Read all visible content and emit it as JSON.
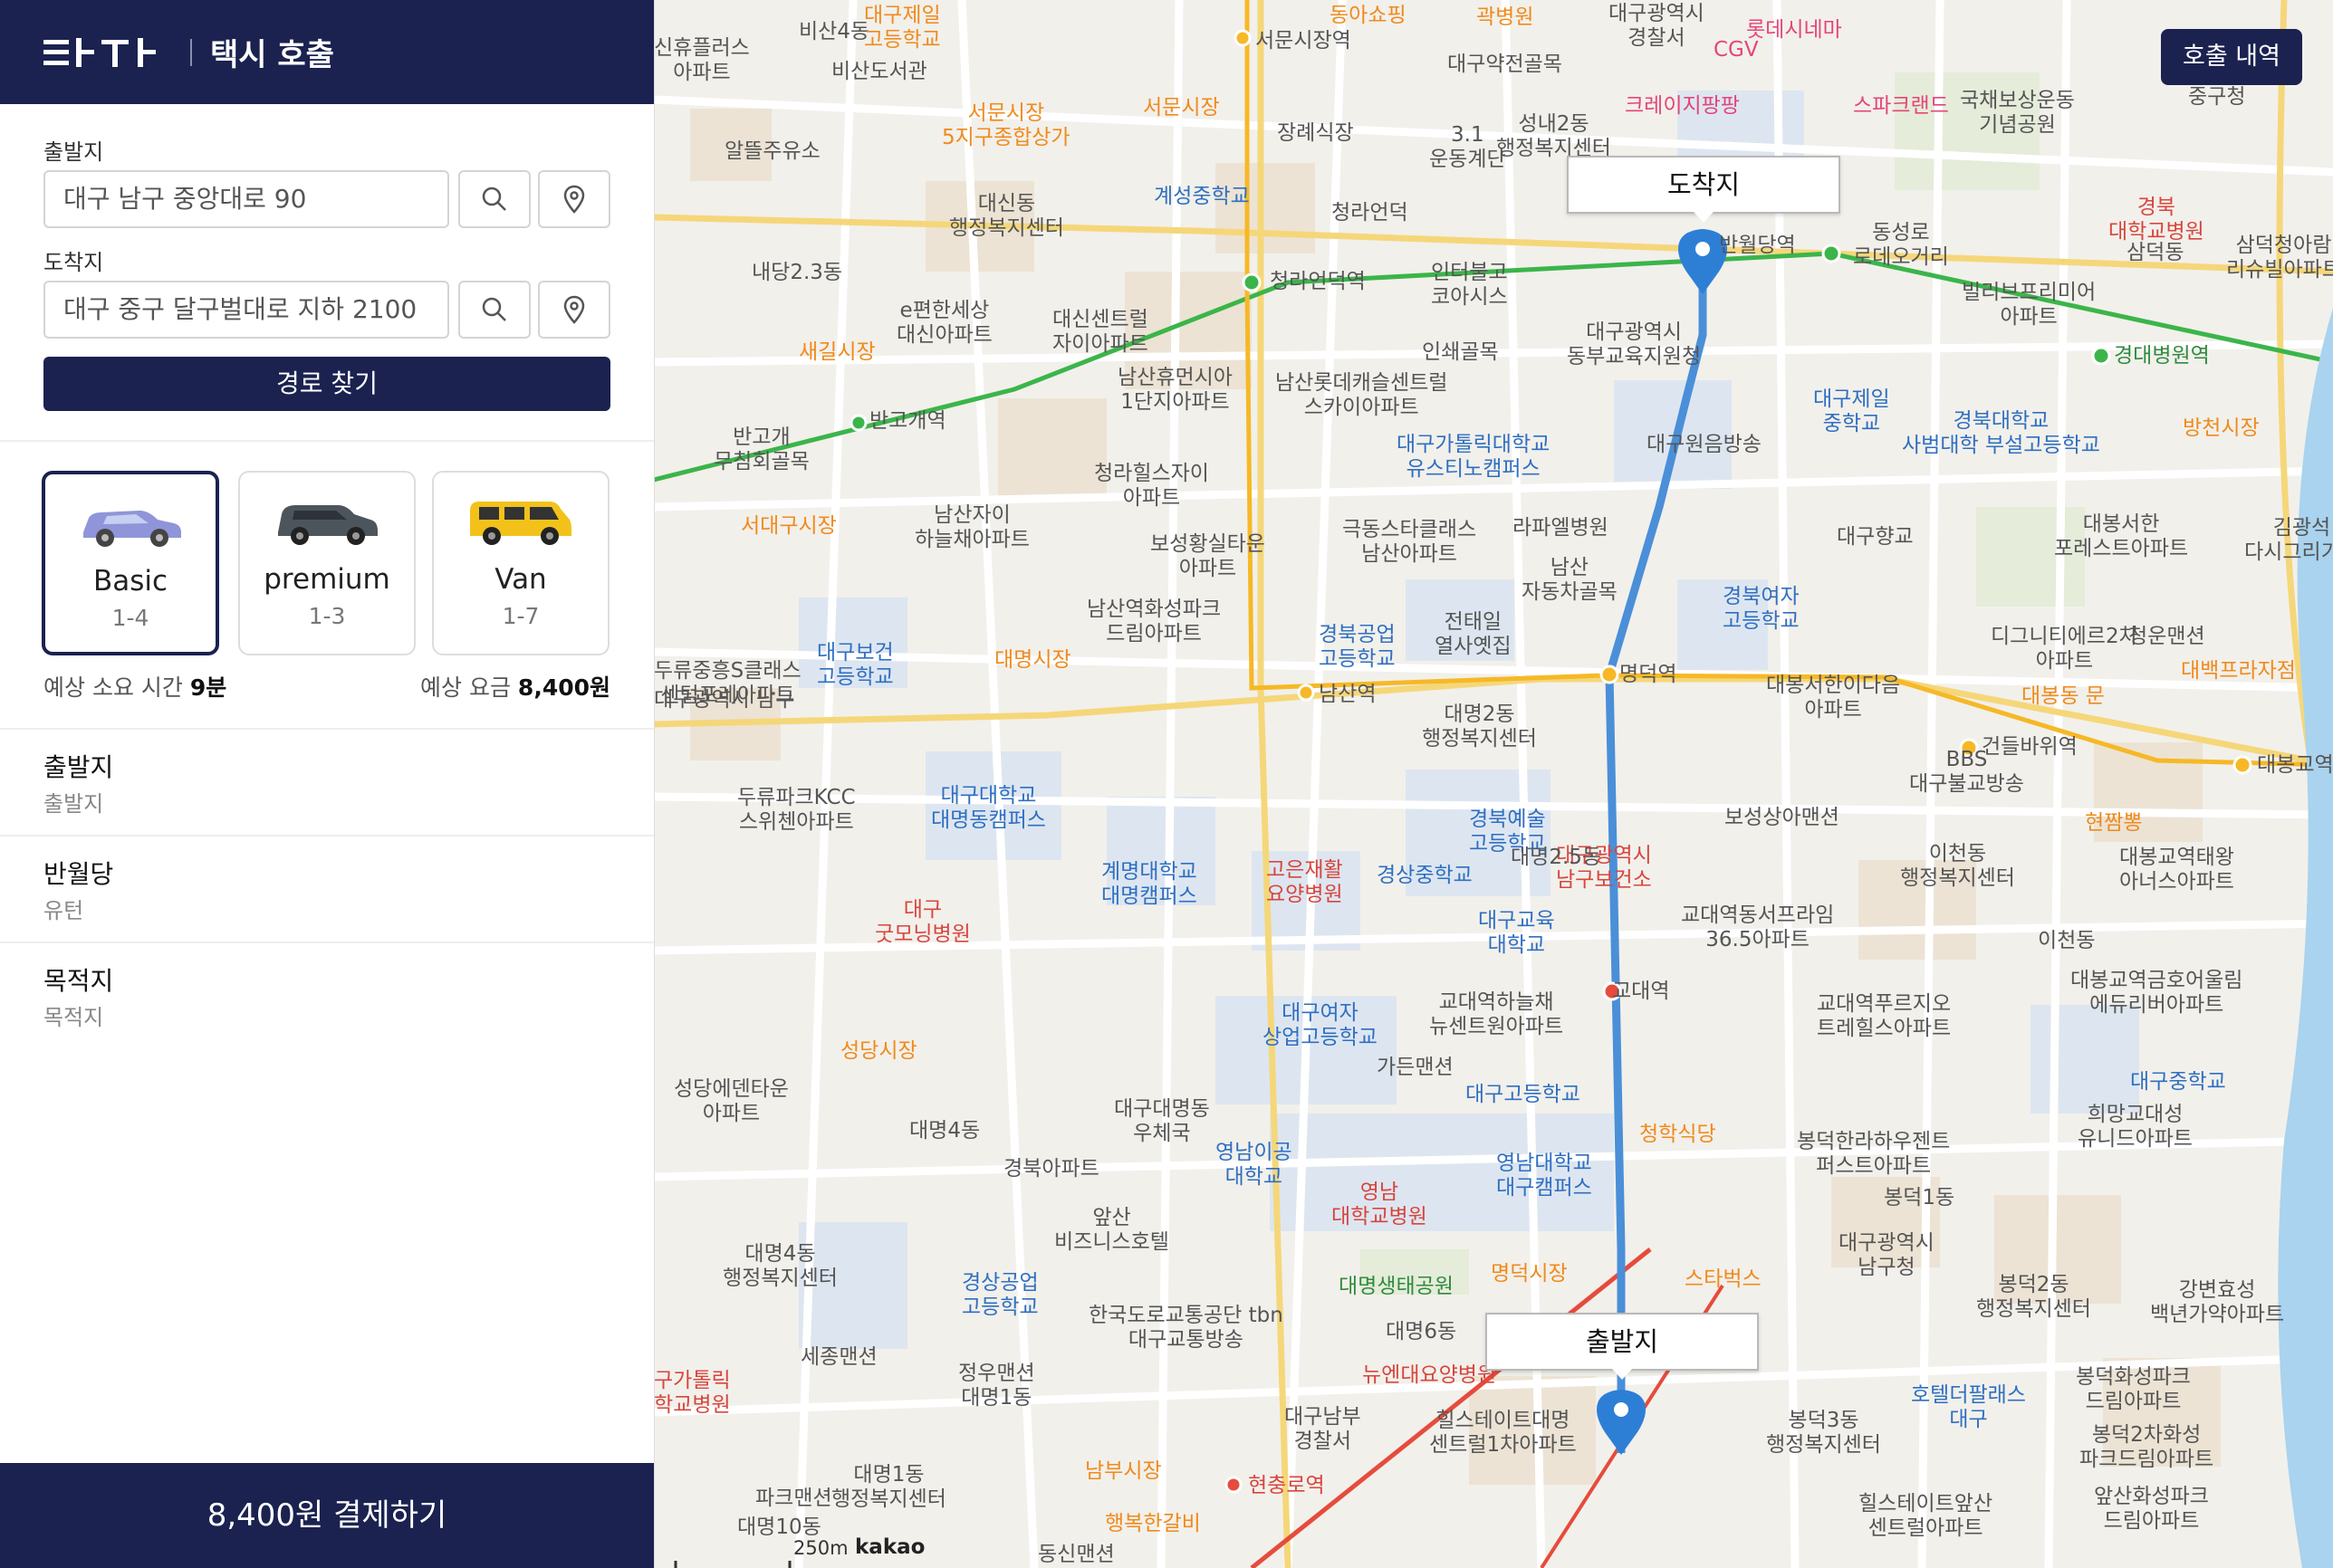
{
  "header": {
    "brand": "타다",
    "title": "택시 호출"
  },
  "form": {
    "origin_label": "출발지",
    "origin_value": "대구 남구 중앙대로 90",
    "destination_label": "도착지",
    "destination_value": "대구 중구 달구벌대로 지하 2100",
    "route_button": "경로 찾기"
  },
  "vehicles": [
    {
      "name": "Basic",
      "capacity": "1-4",
      "color": "#8f95d8",
      "selected": true
    },
    {
      "name": "premium",
      "capacity": "1-3",
      "color": "#4d555c",
      "selected": false
    },
    {
      "name": "Van",
      "capacity": "1-7",
      "color": "#f2c21b",
      "selected": false
    }
  ],
  "estimate": {
    "time_label": "예상 소요 시간",
    "time_value": "9분",
    "fare_label": "예상 요금",
    "fare_value": "8,400원"
  },
  "stops": [
    {
      "title": "출발지",
      "sub": "출발지"
    },
    {
      "title": "반월당",
      "sub": "유턴"
    },
    {
      "title": "목적지",
      "sub": "목적지"
    }
  ],
  "pay_button": "8,400원 결제하기",
  "map": {
    "history_button": "호출 내역",
    "destination_callout": "도착지",
    "origin_callout": "출발지",
    "scale": "250m",
    "attribution": "kakao",
    "route_color": "#4a8fd8",
    "labels": {
      "l1": "비산4동",
      "l2": "대구제일\n고등학교",
      "l3": "신휴플러스\n아파트",
      "l4": "비산도서관",
      "l5": "서문시장역",
      "l6": "대구약전골목",
      "l7": "성내2동\n행정복지센터",
      "l8": "알뜰주유소",
      "l9": "서문시장\n5지구종합상가",
      "l10": "서문시장",
      "l11": "장례식장",
      "l12": "3.1\n운동계단",
      "l13": "계성중학교",
      "l14": "대신동\n행정복지센터",
      "l15": "청라언덕",
      "l16": "반월당역",
      "l17": "동성로\n로데오거리",
      "l18": "내당2.3동",
      "l19": "청라언덕역",
      "l20": "인터불고\n코아시스",
      "l21": "대구광역시\n동부교육지원청",
      "l22": "e편한세상\n대신아파트",
      "l23": "대신센트럴\n자이아파트",
      "l24": "새길시장",
      "l25": "빌리브프리미어\n아파트",
      "l26": "경대병원역",
      "l27": "남산휴먼시아\n1단지아파트",
      "l28": "인쇄골목",
      "l29": "남산롯데캐슬센트럴\n스카이아파트",
      "l30": "반고개역",
      "l31": "반고개\n무침회골목",
      "l32": "대구가톨릭대학교\n유스티노캠퍼스",
      "l33": "대구원음방송",
      "l34": "대구제일\n중학교",
      "l35": "경북대학교\n사범대학 부설고등학교",
      "l36": "방천시장",
      "l37": "청라힐스자이\n아파트",
      "l38": "서대구시장",
      "l39": "남산자이\n하늘채아파트",
      "l40": "보성황실타운\n아파트",
      "l41": "극동스타클래스\n남산아파트",
      "l42": "라파엘병원",
      "l43": "대구향교",
      "l44": "대봉서한\n포레스트아파트",
      "l45": "김광석\n다시그리기길",
      "l46": "남산\n자동차골목",
      "l47": "경북여자\n고등학교",
      "l48": "남산역화성파크\n드림아파트",
      "l49": "경북공업\n고등학교",
      "l50": "전태일\n열사옛집",
      "l51": "대구보건\n고등학교",
      "l52": "대명시장",
      "l53": "남산역",
      "l54": "명덕역",
      "l55": "대봉서한이다음\n아파트",
      "l56": "대봉동 문",
      "l57": "건들바위역",
      "l58": "BBS\n대구불교방송",
      "l59": "대봉교역",
      "l60": "두류중흥S클래스\n센텀포레아파트",
      "l61": "대명2동\n행정복지센터",
      "l62": "두류파크KCC\n스위첸아파트",
      "l63": "대구대학교\n대명동캠퍼스",
      "l64": "경북예술\n고등학교",
      "l65": "대구광역시\n남구보건소",
      "l66": "보성상아맨션",
      "l67": "현짬뽕",
      "l68": "이천동\n행정복지센터",
      "l69": "대봉교역태왕\n아너스아파트",
      "l70": "계명대학교\n대명캠퍼스",
      "l71": "고은재활\n요양병원",
      "l72": "경상중학교",
      "l73": "대구교육\n대학교",
      "l74": "교대역동서프라임\n36.5아파트",
      "l75": "대구\n굿모닝병원",
      "l76": "이천동",
      "l77": "교대역",
      "l78": "대봉교역금호어울림\n에듀리버아파트",
      "l79": "대구여자\n상업고등학교",
      "l80": "교대역하늘채\n뉴센트원아파트",
      "l81": "교대역푸르지오\n트레힐스아파트",
      "l82": "성당시장",
      "l83": "가든맨션",
      "l84": "대구고등학교",
      "l85": "대구중학교",
      "l86": "희망교대성\n유니드아파트",
      "l87": "성당에덴타운\n아파트",
      "l88": "대명4동",
      "l89": "대구대명동\n우체국",
      "l90": "영남이공\n대학교",
      "l91": "청학식당",
      "l92": "봉덕한라하우젠트\n퍼스트아파트",
      "l93": "경북아파트",
      "l94": "영남대학교\n대구캠퍼스",
      "l95": "영남\n대학교병원",
      "l96": "봉덕1동",
      "l97": "앞산\n비즈니스호텔",
      "l98": "대구광역시\n남구청",
      "l99": "대명4동\n행정복지센터",
      "l100": "경상공업\n고등학교",
      "l101": "대명생태공원",
      "l102": "명덕시장",
      "l103": "스타벅스",
      "l104": "봉덕2동\n행정복지센터",
      "l105": "강변효성\n백년가약아파트",
      "l106": "한국도로교통공단 tbn\n대구교통방송",
      "l107": "세종맨션",
      "l108": "대명6동",
      "l109": "뉴엔대요양병원",
      "l110": "호텔더팔래스\n대구",
      "l111": "봉덕화성파크\n드림아파트",
      "l112": "구가톨릭\n학교병원",
      "l113": "정우맨션\n대명1동",
      "l114": "대구남부\n경찰서",
      "l115": "힐스테이트대명\n센트럴1차아파트",
      "l116": "봉덕3동\n행정복지센터",
      "l117": "봉덕2차화성\n파크드림아파트",
      "l118": "대명1동\n행정복지센터",
      "l119": "남부시장",
      "l120": "현충로역",
      "l121": "파크맨션",
      "l122": "대명10동",
      "l123": "힐스테이트앞산\n센트럴아파트",
      "l124": "앞산화성파크\n드림아파트",
      "l125": "행복한갈비",
      "l126": "동신맨션",
      "l127": "롯데시네마",
      "l128": "CGV",
      "l129": "크레이지팡팡",
      "l130": "스파크랜드",
      "l131": "국채보상운동\n기념공원",
      "l132": "중구청",
      "l133": "경북\n대학교병원",
      "l134": "삼덕동",
      "l135": "삼덕청아람\n리슈빌아파트",
      "l136": "대명2.5동",
      "l137": "대구광역시 남구",
      "l138": "곽병원",
      "l139": "동아쇼핑",
      "l140": "디그니티에르2차\n아파트",
      "l141": "청운맨션",
      "l142": "대백프라자점",
      "l143": "대구광역시\n경찰서"
    }
  }
}
